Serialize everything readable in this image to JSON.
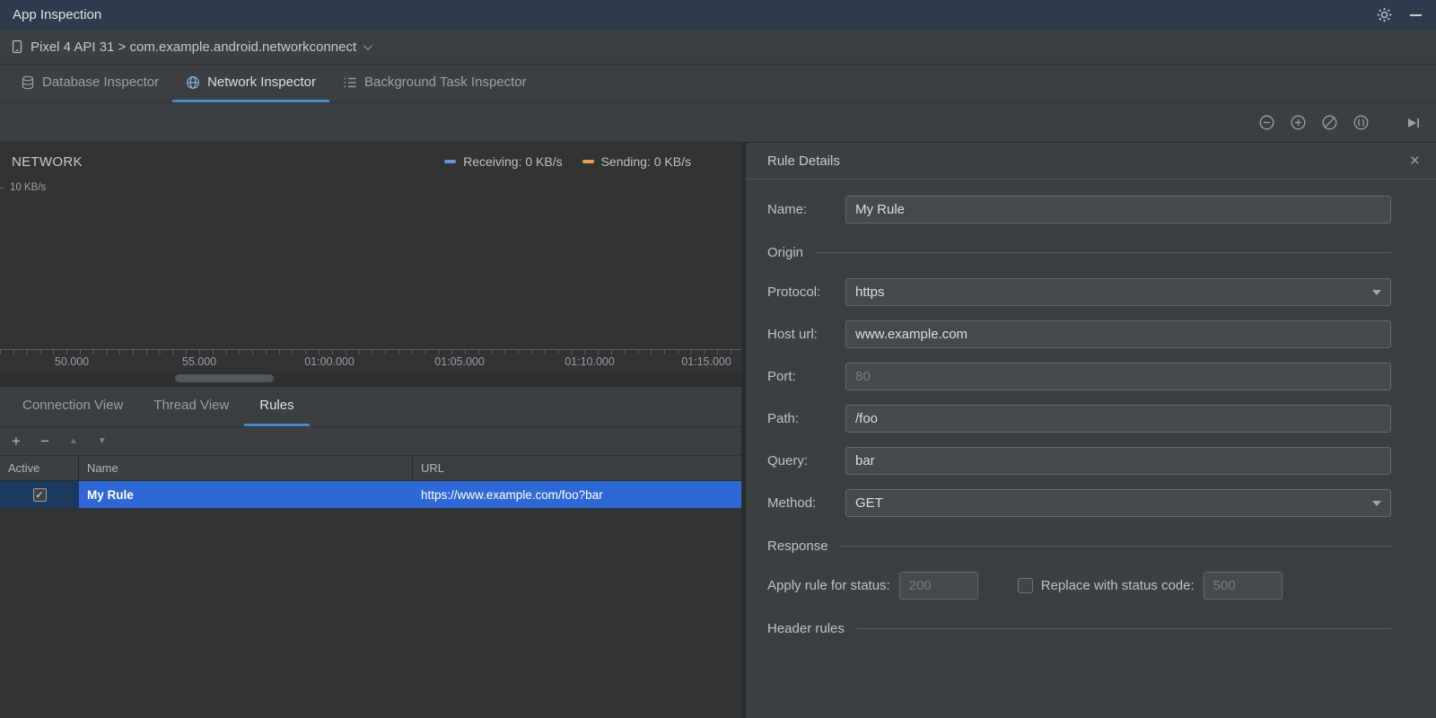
{
  "window": {
    "title": "App Inspection"
  },
  "device_bar": {
    "selector": "Pixel 4 API 31 > com.example.android.networkconnect"
  },
  "inspector_tabs": [
    {
      "label": "Database Inspector",
      "active": false
    },
    {
      "label": "Network Inspector",
      "active": true
    },
    {
      "label": "Background Task Inspector",
      "active": false
    }
  ],
  "timeline": {
    "title": "NETWORK",
    "legend": [
      {
        "label": "Receiving: 0 KB/s",
        "color": "#6a8fd8"
      },
      {
        "label": "Sending: 0 KB/s",
        "color": "#e0a456"
      }
    ],
    "y_axis_label": "10 KB/s",
    "time_ticks": [
      "50.000",
      "55.000",
      "01:00.000",
      "01:05.000",
      "01:10.000",
      "01:15.000"
    ]
  },
  "view_tabs": [
    {
      "label": "Connection View",
      "active": false
    },
    {
      "label": "Thread View",
      "active": false
    },
    {
      "label": "Rules",
      "active": true
    }
  ],
  "rules_table": {
    "columns": [
      "Active",
      "Name",
      "URL"
    ],
    "rows": [
      {
        "active": true,
        "name": "My Rule",
        "url": "https://www.example.com/foo?bar"
      }
    ]
  },
  "rule_details": {
    "title": "Rule Details",
    "name_label": "Name:",
    "name_value": "My Rule",
    "sections": {
      "origin": "Origin",
      "response": "Response",
      "header_rules": "Header rules"
    },
    "origin": {
      "protocol_label": "Protocol:",
      "protocol_value": "https",
      "host_label": "Host url:",
      "host_value": "www.example.com",
      "port_label": "Port:",
      "port_placeholder": "80",
      "path_label": "Path:",
      "path_value": "/foo",
      "query_label": "Query:",
      "query_value": "bar",
      "method_label": "Method:",
      "method_value": "GET"
    },
    "response": {
      "apply_label": "Apply rule for status:",
      "apply_placeholder": "200",
      "replace_label": "Replace with status code:",
      "replace_placeholder": "500",
      "replace_checked": false
    }
  },
  "colors": {
    "accent": "#4a88c7",
    "selection": "#2f68d5",
    "titlebar": "#2d3b4c"
  },
  "icons": {
    "close": "×",
    "check": "✓",
    "add": "+",
    "remove": "−",
    "move_up": "▲",
    "move_down": "▼"
  }
}
